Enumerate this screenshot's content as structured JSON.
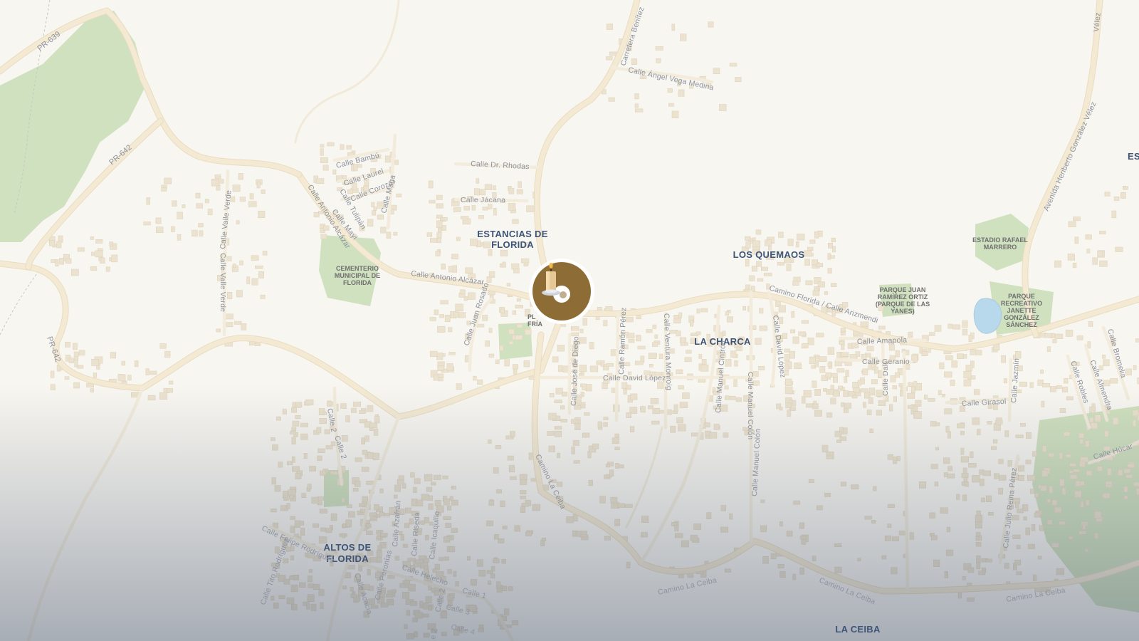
{
  "map": {
    "colors": {
      "land": "#f8f6f0",
      "road": "#f4ead4",
      "park": "#c9ddb6",
      "water": "#b8d8ec",
      "place_label": "#3d5478",
      "marker_fill": "#8d6c35"
    },
    "places": {
      "estancias_1": "ESTANCIAS DE",
      "estancias_2": "FLORIDA",
      "los_quemaos": "LOS QUEMAOS",
      "la_charca": "LA CHARCA",
      "altos_1": "ALTOS DE",
      "altos_2": "FLORIDA",
      "la_ceiba": "LA CEIBA",
      "es_partial": "ES"
    },
    "pois": {
      "cementerio_1": "CEMENTERIO",
      "cementerio_2": "MUNICIPAL DE",
      "cementerio_3": "FLORIDA",
      "estadio_1": "ESTADIO RAFAEL",
      "estadio_2": "MARRERO",
      "parque_jr_1": "PARQUE JUAN",
      "parque_jr_2": "RAMÍREZ ORTIZ",
      "parque_jr_3": "(PARQUE DE LAS",
      "parque_jr_4": "YANES)",
      "parque_rec_1": "PARQUE",
      "parque_rec_2": "RECREATIVO",
      "parque_rec_3": "JANETTE",
      "parque_rec_4": "GONZÁLEZ",
      "parque_rec_5": "SÁNCHEZ",
      "plaza_1": "PL",
      "plaza_2": "FRÍA"
    },
    "roads": {
      "pr639": "PR-639",
      "pr642_a": "PR-642",
      "pr642_b": "PR-642",
      "carretera_benitez": "Carretera Benítez",
      "angel_vega": "Calle Ángel Vega Medina",
      "velez_top": "Vélez",
      "heriberto": "Avenida Heriberto González Vélez",
      "bambu": "Calle Bambú",
      "laurel": "Calle Laurel",
      "corozo": "Calle Corozo",
      "tulipan": "Calle Tulipán",
      "maga": "Calle Maga",
      "mayi": "Calle Mayi",
      "alcazar_diag": "Calle Antonio Alcázar",
      "alcazar_horiz": "Calle Antonio Alcázar",
      "dr_rhodas": "Calle Dr. Rhodas",
      "jacana": "Calle Jácana",
      "valle_verde_1": "Calle Valle Verde",
      "valle_verde_2": "Calle Valle Verde",
      "juan_rosado": "Calle Juan Rosado",
      "jose_de_diego": "Calle José de Diego",
      "ramon_perez": "Calle Ramón Pérez",
      "ventura_monroig": "Calle Ventura Monroig",
      "manuel_cintron": "Calle Manuel Cintrón",
      "manuel_colon_1": "Calle Manuel Colón",
      "manuel_colon_2": "Calle Manuel Colón",
      "david_lopez_h": "Calle David López",
      "david_lopez_v": "Calle David López",
      "camino_florida": "Camino Florida / Calle Arizmendi",
      "amapola": "Calle Amapola",
      "geranio": "Calle Geranio",
      "dali": "Calle Dalí",
      "girasol": "Calle Girasol",
      "jazmin": "Calle Jazmín",
      "robles": "Calle Robles",
      "almendra": "Calle Almendra",
      "bromelia": "Calle Bromelia",
      "hucar": "Calle Húcar",
      "julio_reina": "Calle Julio Reina Pérez",
      "camino_ceiba_v": "Camino La Ceiba",
      "camino_ceiba_1": "Camino La Ceiba",
      "camino_ceiba_2": "Camino La Ceiba",
      "camino_ceiba_3": "Camino La Ceiba",
      "calle2_a": "Calle 2",
      "calle2_b": "Calle 2",
      "calle2_c": "Calle 2",
      "calle1": "Calle 1",
      "calle3": "Calle 3",
      "calle4": "Calle 4",
      "azafran": "Calle Azafrán",
      "riseda": "Calle Riseda",
      "icaquillo": "Calle Icaquillo",
      "felipe_rodriguez": "Calle Felipe Rodríguez",
      "tito_rodriguez": "Calle Tito Rodríguez",
      "peronias": "Calle Peronías",
      "helecho": "Calle Helecho",
      "acacia": "Calle Acacia",
      "calle_e": "e 2"
    },
    "marker": {
      "icon": "candle-icon"
    }
  }
}
